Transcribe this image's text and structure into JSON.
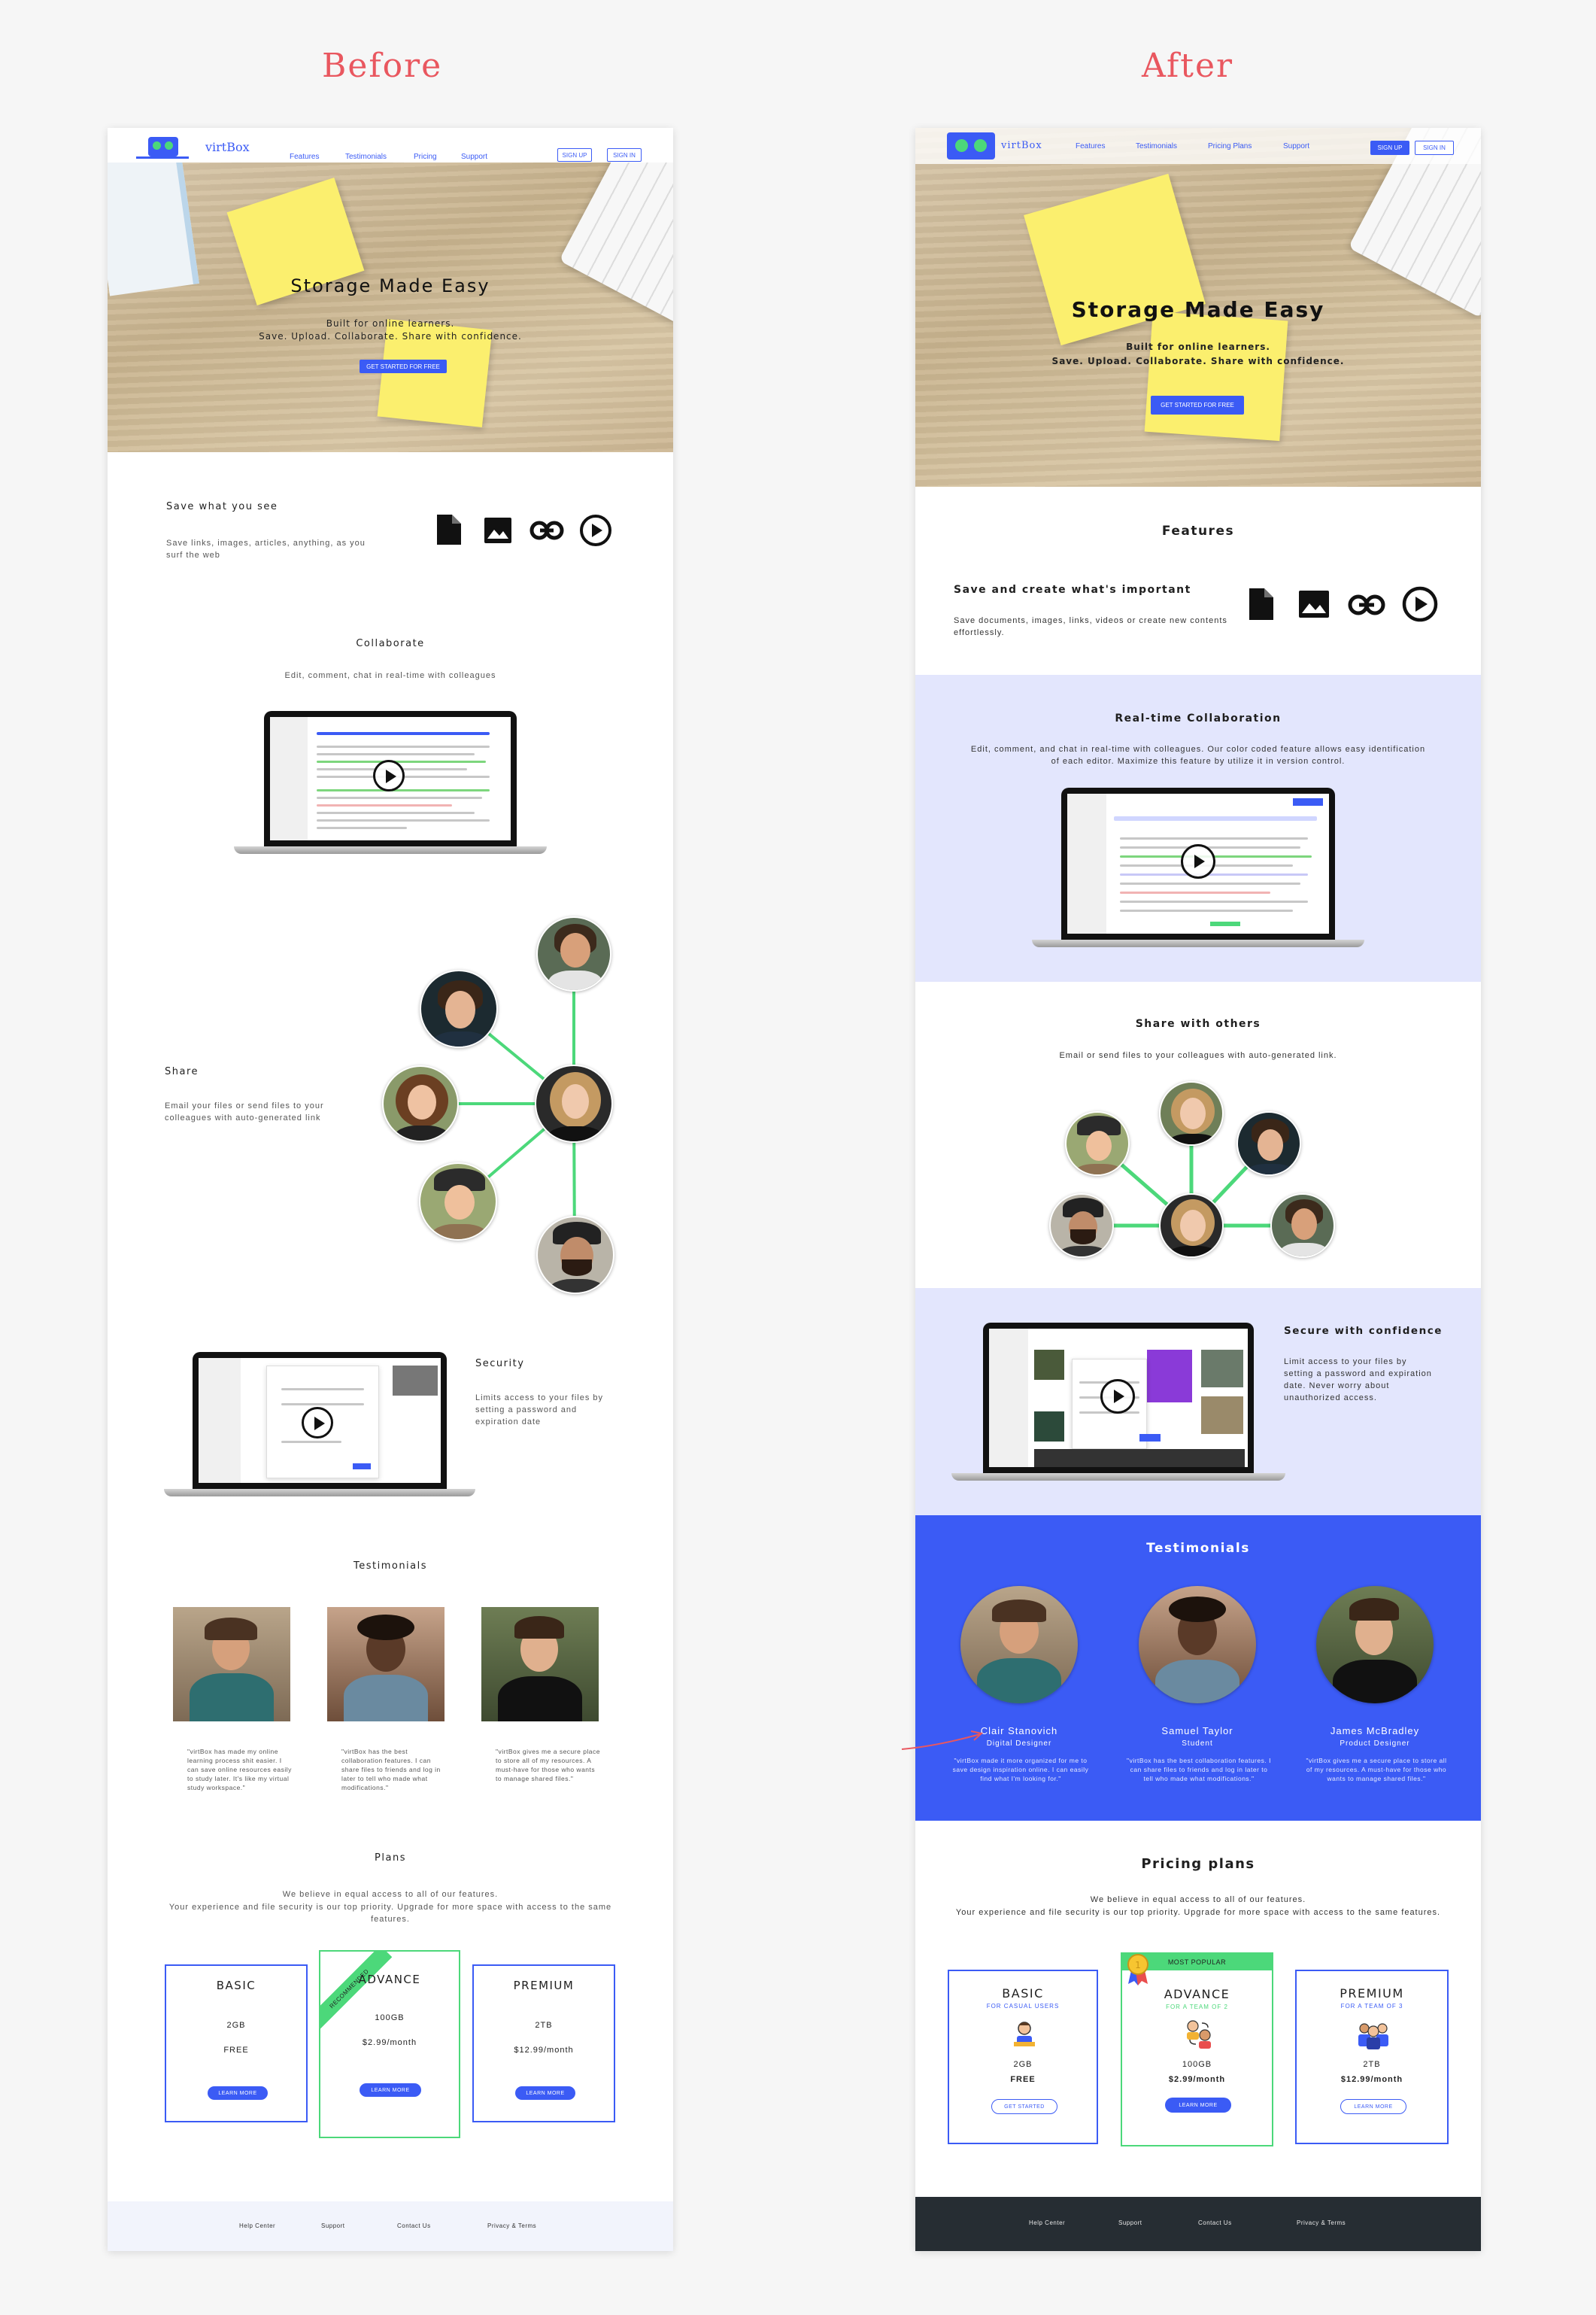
{
  "headings": {
    "before": "Before",
    "after": "After"
  },
  "before": {
    "nav": {
      "logo": "virtBox",
      "links": [
        "Features",
        "Testimonials",
        "Pricing",
        "Support"
      ],
      "signup": "SIGN UP",
      "signin": "SIGN IN"
    },
    "hero": {
      "title": "Storage Made Easy",
      "line1": "Built for online learners.",
      "line2": "Save. Upload. Collaborate. Share with confidence.",
      "cta": "GET STARTED FOR FREE"
    },
    "save": {
      "title": "Save what you see",
      "text": "Save links, images, articles, anything, as you surf the web"
    },
    "collaborate": {
      "title": "Collaborate",
      "text": "Edit, comment, chat in real-time with colleagues"
    },
    "share": {
      "title": "Share",
      "text": "Email your files or send files to your colleagues with auto-generated link"
    },
    "security": {
      "title": "Security",
      "text": "Limits access to your files by setting a password and expiration date"
    },
    "testimonials": {
      "title": "Testimonials",
      "items": [
        {
          "quote": "\"virtBox has made my online learning process shit easier. I can save online resources easily to study later. It's like my virtual study workspace.\""
        },
        {
          "quote": "\"virtBox has the best collaboration features. I can share files to friends and log in later to tell who made what modifications.\""
        },
        {
          "quote": "\"virtBox gives me a secure place to store all of my resources. A must-have for those who wants to manage shared files.\""
        }
      ]
    },
    "plans": {
      "title": "Plans",
      "text1": "We believe in equal access to all of our features.",
      "text2": "Your experience and file security is our top priority. Upgrade for more space with access to the same features.",
      "ribbon": "RECOMMENDED",
      "items": [
        {
          "name": "BASIC",
          "storage": "2GB",
          "price": "FREE",
          "cta": "LEARN MORE"
        },
        {
          "name": "ADVANCE",
          "storage": "100GB",
          "price": "$2.99/month",
          "cta": "LEARN MORE"
        },
        {
          "name": "PREMIUM",
          "storage": "2TB",
          "price": "$12.99/month",
          "cta": "LEARN MORE"
        }
      ]
    },
    "footer": [
      "Help Center",
      "Support",
      "Contact Us",
      "Privacy & Terms"
    ]
  },
  "after": {
    "nav": {
      "logo": "virtBox",
      "links": [
        "Features",
        "Testimonials",
        "Pricing Plans",
        "Support"
      ],
      "signup": "SIGN UP",
      "signin": "SIGN IN"
    },
    "hero": {
      "title": "Storage Made Easy",
      "line1": "Built for online learners.",
      "line2": "Save. Upload. Collaborate. Share with confidence.",
      "cta": "GET STARTED FOR FREE"
    },
    "features": {
      "title": "Features"
    },
    "save": {
      "title": "Save and create what's important",
      "text": "Save documents, images, links, videos or create new contents effortlessly."
    },
    "collaborate": {
      "title": "Real-time Collaboration",
      "text": "Edit, comment, and chat in real-time with colleagues. Our color coded feature allows easy identification of each editor. Maximize this feature by utilize it in version control."
    },
    "share": {
      "title": "Share with others",
      "text": "Email or send files to your colleagues with auto-generated link."
    },
    "security": {
      "title": "Secure with confidence",
      "text": "Limit access to your files by setting a password and expiration date. Never worry about unauthorized access."
    },
    "testimonials": {
      "title": "Testimonials",
      "items": [
        {
          "name": "Clair Stanovich",
          "role": "Digital Designer",
          "quote": "\"virtBox made it more organized for me to save design inspiration online. I can easily find what I'm looking for.\""
        },
        {
          "name": "Samuel Taylor",
          "role": "Student",
          "quote": "\"virtBox has the best collaboration features. I can share files to friends and log in later to tell who made what modifications.\""
        },
        {
          "name": "James McBradley",
          "role": "Product Designer",
          "quote": "\"virtBox gives me a secure place to store all of my resources. A must-have for those who wants to manage shared files.\""
        }
      ]
    },
    "plans": {
      "title": "Pricing plans",
      "text1": "We believe in equal access to all of our features.",
      "text2": "Your experience and file security is our top priority. Upgrade for more space with access to the same features.",
      "badge": "MOST POPULAR",
      "items": [
        {
          "name": "BASIC",
          "sub": "FOR CASUAL USERS",
          "storage": "2GB",
          "price": "FREE",
          "cta": "GET STARTED"
        },
        {
          "name": "ADVANCE",
          "sub": "FOR A TEAM OF 2",
          "storage": "100GB",
          "price": "$2.99/month",
          "cta": "LEARN MORE"
        },
        {
          "name": "PREMIUM",
          "sub": "FOR A TEAM OF 3",
          "storage": "2TB",
          "price": "$12.99/month",
          "cta": "LEARN MORE"
        }
      ]
    },
    "footer": [
      "Help Center",
      "Support",
      "Contact Us",
      "Privacy & Terms"
    ]
  },
  "colors": {
    "brand_blue": "#3b5bf5",
    "accent_green": "#4cd87a",
    "lavender": "#e3e6fd",
    "footer_dark": "#262d33",
    "heading_red": "#e9575f"
  }
}
